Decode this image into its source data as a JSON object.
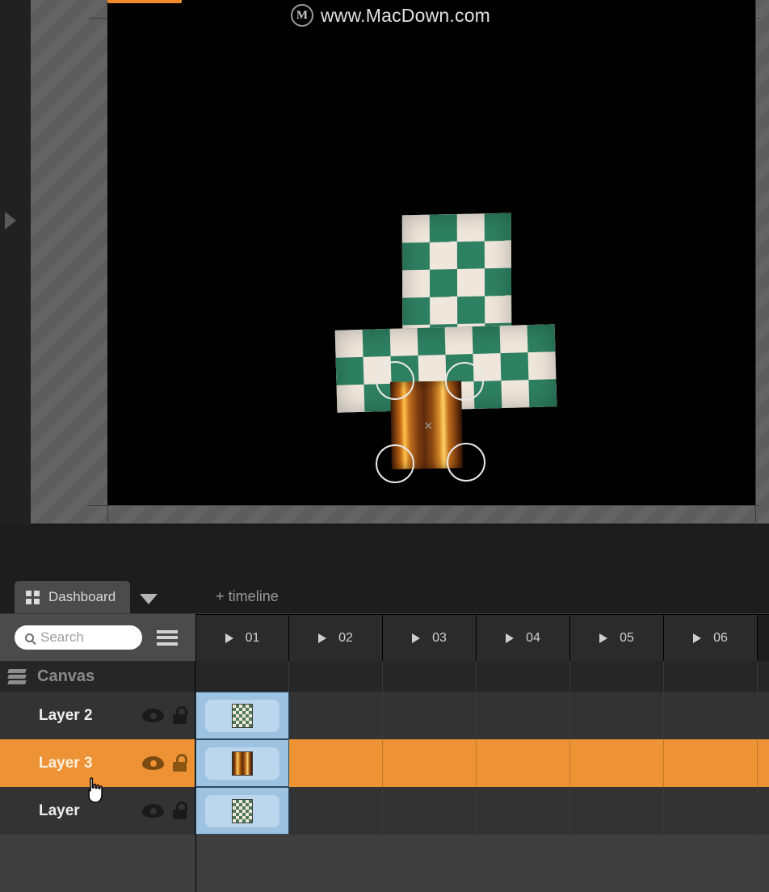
{
  "watermark": {
    "logo_letter": "M",
    "text": "www.MacDown.com",
    "icon": "macdown-circle-logo"
  },
  "viewport": {
    "expand_arrow_icon": "triangle-right-icon",
    "canvas_background": "#000000",
    "selection_handle_icon": "circle-handle",
    "center_marker": "×"
  },
  "tabs": {
    "active": {
      "label": "Dashboard",
      "icon": "grid-2x2-icon"
    },
    "dropdown_icon": "triangle-down-icon",
    "add_timeline_label": "+ timeline"
  },
  "toolbar": {
    "search": {
      "placeholder": "Search",
      "value": "",
      "icon": "search-icon"
    },
    "menu_icon": "hamburger-menu-icon"
  },
  "timeline": {
    "columns": [
      {
        "label": "01",
        "icon": "play-icon"
      },
      {
        "label": "02",
        "icon": "play-icon"
      },
      {
        "label": "03",
        "icon": "play-icon"
      },
      {
        "label": "04",
        "icon": "play-icon"
      },
      {
        "label": "05",
        "icon": "play-icon"
      },
      {
        "label": "06",
        "icon": "play-icon"
      }
    ]
  },
  "group": {
    "label": "Canvas",
    "icon": "layers-stack-icon"
  },
  "layers": [
    {
      "name": "Layer 2",
      "visible_icon": "eye-icon",
      "lock_icon": "unlock-icon",
      "selected": false,
      "keyframe_thumbnail": "checkerboard-thumb"
    },
    {
      "name": "Layer 3",
      "visible_icon": "eye-icon",
      "lock_icon": "unlock-icon",
      "selected": true,
      "keyframe_thumbnail": "wood-thumb"
    },
    {
      "name": "Layer",
      "visible_icon": "eye-icon",
      "lock_icon": "unlock-icon",
      "selected": false,
      "keyframe_thumbnail": "checkerboard-thumb"
    }
  ],
  "colors": {
    "selection_orange": "#ed9336",
    "keyframe_blue": "#9dc3e0",
    "panel_dark": "#333333",
    "toolbar_gray": "#4b4b4b"
  },
  "cursor": {
    "icon": "pointing-hand-cursor"
  }
}
